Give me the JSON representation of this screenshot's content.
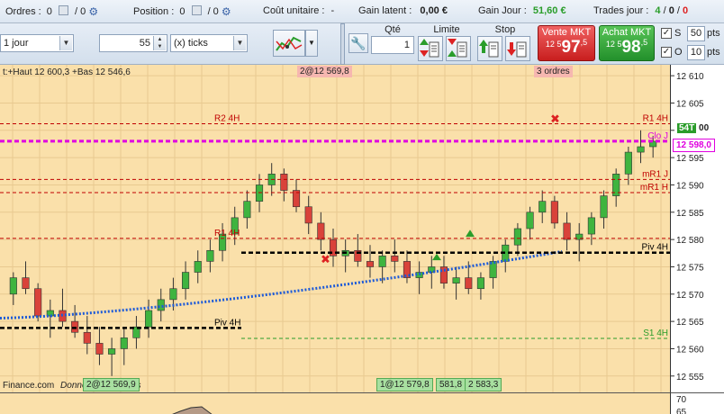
{
  "status": {
    "orders_label": "Ordres :",
    "orders_value": "0",
    "orders_slash": "/ 0",
    "position_label": "Position :",
    "position_value": "0",
    "position_slash": "/ 0",
    "unit_cost_label": "Coût unitaire :",
    "unit_cost_value": "-",
    "latent_label": "Gain latent :",
    "latent_value": "0,00 €",
    "day_gain_label": "Gain Jour :",
    "day_gain_value": "51,60 €",
    "trades_label": "Trades jour :",
    "trades_a": "4",
    "trades_b": "0",
    "trades_c": "0"
  },
  "toolbar": {
    "timeframe": "1 jour",
    "ticks_value": "55",
    "ticks_unit": "(x) ticks",
    "qty_label": "Qté",
    "qty_value": "1",
    "limit_label": "Limite",
    "stop_label": "Stop",
    "sell_label": "Vente MKT",
    "sell_prefix": "12 5",
    "sell_main": "97",
    "sell_sup": ",5",
    "buy_label": "Achat MKT",
    "buy_prefix": "12 5",
    "buy_main": "98",
    "buy_sup": ",5",
    "s_label": "S",
    "s_value": "50",
    "s_unit": "pts",
    "o_label": "O",
    "o_value": "10",
    "o_unit": "pts"
  },
  "chart": {
    "top_info": "t:+Haut 12 600,3 +Bas 12 546,6",
    "order_tag_top": "2@12 569,8",
    "orders_count_tag": "3 ordres",
    "order_tag_bottom_left": "2@12 569,9",
    "order_tag_bottom_mid": "1@12 579,8",
    "order_tag_581": "581,8",
    "order_tag_583": "2 583,3",
    "footer_source": "Finance.com",
    "footer_note": "Données indicatives",
    "levels": [
      {
        "name": "R2 4H",
        "value": 12601.2,
        "color": "#c00000",
        "style": "dash",
        "label_pos": "left"
      },
      {
        "name": "R1 4H",
        "value": 12601.2,
        "color": "#c00000",
        "style": "none",
        "label_pos": "right"
      },
      {
        "name": "Clo J",
        "value": 12598.0,
        "color": "#e000e0",
        "style": "thick",
        "label_pos": "right"
      },
      {
        "name": "mR1 J",
        "value": 12591.0,
        "color": "#c00000",
        "style": "dash",
        "label_pos": "right"
      },
      {
        "name": "mR1 H",
        "value": 12588.6,
        "color": "#c00000",
        "style": "dash",
        "label_pos": "right"
      },
      {
        "name": "R1 4H",
        "value": 12580.2,
        "color": "#c00000",
        "style": "dash",
        "label_pos": "left"
      },
      {
        "name": "Piv 4H",
        "value": 12577.6,
        "color": "#000000",
        "style": "thick",
        "label_pos": "right"
      },
      {
        "name": "Piv 4H",
        "value": 12563.8,
        "color": "#000000",
        "style": "thick",
        "label_pos": "left"
      },
      {
        "name": "S1 4H",
        "value": 12561.9,
        "color": "#2a9d2a",
        "style": "dash",
        "label_pos": "right"
      }
    ],
    "price_tag_54": "54T",
    "price_tag_00": "00",
    "price_tag_close": "12 598,0",
    "y_ticks": [
      "12 610",
      "12 605",
      "12 600",
      "12 595",
      "12 590",
      "12 585",
      "12 580",
      "12 575",
      "12 570",
      "12 565",
      "12 560",
      "12 555"
    ],
    "sub_ticks": [
      "70",
      "65"
    ]
  },
  "chart_data": {
    "type": "candlestick",
    "ylim": [
      12552,
      12612
    ],
    "candles": [
      [
        12570,
        12574,
        12568,
        12573
      ],
      [
        12573,
        12576,
        12570,
        12571
      ],
      [
        12571,
        12572,
        12565,
        12566
      ],
      [
        12566,
        12569,
        12562,
        12567
      ],
      [
        12567,
        12571,
        12564,
        12565
      ],
      [
        12565,
        12568,
        12562,
        12563
      ],
      [
        12563,
        12566,
        12559,
        12561
      ],
      [
        12561,
        12564,
        12557,
        12559
      ],
      [
        12559,
        12562,
        12555,
        12560
      ],
      [
        12560,
        12564,
        12557,
        12562
      ],
      [
        12562,
        12566,
        12560,
        12564
      ],
      [
        12564,
        12569,
        12562,
        12567
      ],
      [
        12567,
        12571,
        12565,
        12569
      ],
      [
        12569,
        12573,
        12567,
        12571
      ],
      [
        12571,
        12576,
        12569,
        12574
      ],
      [
        12574,
        12578,
        12572,
        12576
      ],
      [
        12576,
        12580,
        12574,
        12578
      ],
      [
        12578,
        12583,
        12576,
        12581
      ],
      [
        12581,
        12586,
        12579,
        12584
      ],
      [
        12584,
        12589,
        12582,
        12587
      ],
      [
        12587,
        12592,
        12585,
        12590
      ],
      [
        12590,
        12594,
        12588,
        12592
      ],
      [
        12592,
        12593,
        12587,
        12589
      ],
      [
        12589,
        12591,
        12585,
        12586
      ],
      [
        12586,
        12588,
        12581,
        12583
      ],
      [
        12583,
        12585,
        12578,
        12580
      ],
      [
        12580,
        12582,
        12575,
        12577
      ],
      [
        12577,
        12580,
        12574,
        12578
      ],
      [
        12578,
        12581,
        12575,
        12576
      ],
      [
        12576,
        12579,
        12573,
        12575
      ],
      [
        12575,
        12578,
        12572,
        12577
      ],
      [
        12577,
        12580,
        12574,
        12576
      ],
      [
        12576,
        12578,
        12572,
        12573
      ],
      [
        12573,
        12576,
        12570,
        12574
      ],
      [
        12574,
        12577,
        12571,
        12575
      ],
      [
        12575,
        12577,
        12571,
        12572
      ],
      [
        12572,
        12575,
        12569,
        12573
      ],
      [
        12573,
        12576,
        12570,
        12571
      ],
      [
        12571,
        12574,
        12569,
        12573
      ],
      [
        12573,
        12577,
        12571,
        12576
      ],
      [
        12576,
        12580,
        12574,
        12579
      ],
      [
        12579,
        12583,
        12577,
        12582
      ],
      [
        12582,
        12586,
        12580,
        12585
      ],
      [
        12585,
        12589,
        12583,
        12587
      ],
      [
        12587,
        12588,
        12582,
        12583
      ],
      [
        12583,
        12585,
        12578,
        12580
      ],
      [
        12580,
        12583,
        12576,
        12581
      ],
      [
        12581,
        12585,
        12579,
        12584
      ],
      [
        12584,
        12589,
        12582,
        12588
      ],
      [
        12588,
        12593,
        12586,
        12592
      ],
      [
        12592,
        12597,
        12590,
        12596
      ],
      [
        12596,
        12600,
        12594,
        12597
      ],
      [
        12597,
        12599,
        12595,
        12598
      ]
    ],
    "ma_start": 12565.6,
    "ma_end": 12577.8
  }
}
